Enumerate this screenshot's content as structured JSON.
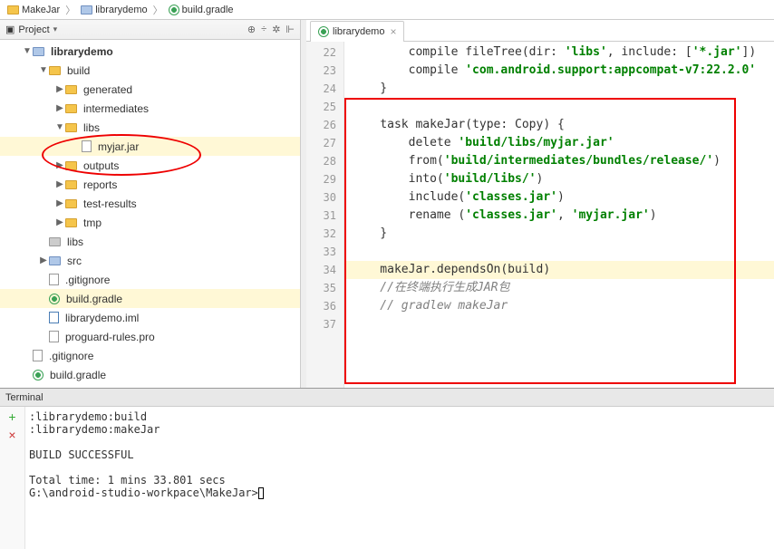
{
  "breadcrumb": [
    {
      "icon": "folder",
      "label": "MakeJar"
    },
    {
      "icon": "folder-blue",
      "label": "librarydemo"
    },
    {
      "icon": "gradle",
      "label": "build.gradle"
    }
  ],
  "sidebar": {
    "header_title": "Project",
    "tools": [
      "⊕",
      "÷",
      "✲",
      "⊩"
    ],
    "tree": [
      {
        "indent": 1,
        "arrow": "▼",
        "icon": "folder-blue",
        "label": "librarydemo",
        "bold": true
      },
      {
        "indent": 2,
        "arrow": "▼",
        "icon": "folder",
        "label": "build"
      },
      {
        "indent": 3,
        "arrow": "▶",
        "icon": "folder",
        "label": "generated"
      },
      {
        "indent": 3,
        "arrow": "▶",
        "icon": "folder",
        "label": "intermediates"
      },
      {
        "indent": 3,
        "arrow": "▼",
        "icon": "folder",
        "label": "libs"
      },
      {
        "indent": 4,
        "arrow": "",
        "icon": "file",
        "label": "myjar.jar",
        "hl": true
      },
      {
        "indent": 3,
        "arrow": "▶",
        "icon": "folder",
        "label": "outputs"
      },
      {
        "indent": 3,
        "arrow": "▶",
        "icon": "folder",
        "label": "reports"
      },
      {
        "indent": 3,
        "arrow": "▶",
        "icon": "folder",
        "label": "test-results"
      },
      {
        "indent": 3,
        "arrow": "▶",
        "icon": "folder",
        "label": "tmp"
      },
      {
        "indent": 2,
        "arrow": "",
        "icon": "folder-gray",
        "label": "libs"
      },
      {
        "indent": 2,
        "arrow": "▶",
        "icon": "folder-blue",
        "label": "src"
      },
      {
        "indent": 2,
        "arrow": "",
        "icon": "file",
        "label": ".gitignore"
      },
      {
        "indent": 2,
        "arrow": "",
        "icon": "gradle",
        "label": "build.gradle",
        "hl": true
      },
      {
        "indent": 2,
        "arrow": "",
        "icon": "file-blue",
        "label": "librarydemo.iml"
      },
      {
        "indent": 2,
        "arrow": "",
        "icon": "file",
        "label": "proguard-rules.pro"
      },
      {
        "indent": 1,
        "arrow": "",
        "icon": "file",
        "label": ".gitignore"
      },
      {
        "indent": 1,
        "arrow": "",
        "icon": "gradle",
        "label": "build.gradle"
      }
    ]
  },
  "editor": {
    "tab_label": "librarydemo",
    "first_line": 22,
    "last_line": 37,
    "code": {
      "l22": {
        "pre": "        compile fileTree(dir: ",
        "s1": "'libs'",
        "mid1": ", include: [",
        "s2": "'*.jar'",
        "end": "])"
      },
      "l23": {
        "pre": "        compile ",
        "s1": "'com.android.support:appcompat-v7:22.2.0'"
      },
      "l24": "    }",
      "l25": "",
      "l26": {
        "pre": "    task makeJar(type: Copy) {"
      },
      "l27": {
        "pre": "        delete ",
        "s1": "'build/libs/myjar.jar'"
      },
      "l28": {
        "pre": "        from(",
        "s1": "'build/intermediates/bundles/release/'",
        "end": ")"
      },
      "l29": {
        "pre": "        into(",
        "s1": "'build/libs/'",
        "end": ")"
      },
      "l30": {
        "pre": "        include(",
        "s1": "'classes.jar'",
        "end": ")"
      },
      "l31": {
        "pre": "        rename (",
        "s1": "'classes.jar'",
        "mid": ", ",
        "s2": "'myjar.jar'",
        "end": ")"
      },
      "l32": "    }",
      "l33": "",
      "l34": "    makeJar.dependsOn(build)",
      "l35": "    //在终端执行生成JAR包",
      "l36": "    // gradlew makeJar",
      "l37": ""
    }
  },
  "terminal": {
    "title": "Terminal",
    "lines": [
      ":librarydemo:build",
      ":librarydemo:makeJar",
      "",
      "BUILD SUCCESSFUL",
      "",
      "Total time: 1 mins 33.801 secs"
    ],
    "prompt": "G:\\android-studio-workpace\\MakeJar>"
  }
}
